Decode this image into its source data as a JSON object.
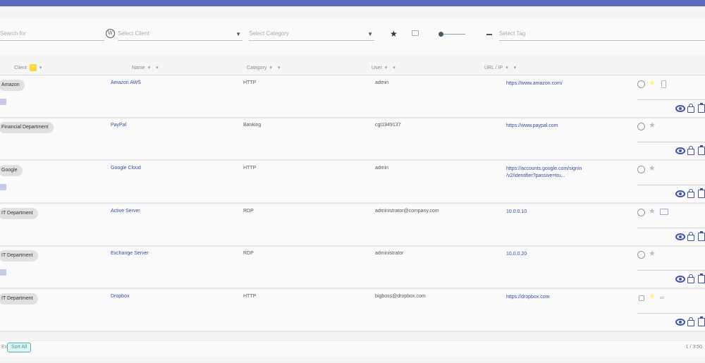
{
  "filters": {
    "search_placeholder": "Search for",
    "client_placeholder": "Select Client",
    "category_placeholder": "Select Category",
    "tag_placeholder": "Select Tag",
    "wordpress_icon_glyph": "W",
    "star_glyph": "★",
    "caret_glyph": "▼"
  },
  "columns": {
    "client": "Client",
    "name": "Name",
    "category": "Category",
    "user": "User",
    "url": "URL / IP",
    "sort_glyphs": "▾ ▾",
    "client_badge_glyph": "+"
  },
  "rows": [
    {
      "client": "Amazon",
      "name": "Amazon AWS",
      "category": "HTTP",
      "user": "admin",
      "url": "https://www.amazon.com/",
      "url2": "",
      "has_square": true,
      "icons": [
        "clock",
        "star-gold",
        "clipboard-grey"
      ]
    },
    {
      "client": "Financial Department",
      "name": "PayPal",
      "category": "Banking",
      "user": "cgt1949137",
      "url": "https://www.paypal.com",
      "url2": "",
      "has_square": false,
      "icons": [
        "clock",
        "star"
      ]
    },
    {
      "client": "Google",
      "name": "Google Cloud",
      "category": "HTTP",
      "user": "admin",
      "url": "https://accounts.google.com/signin",
      "url2": "/v2/identifier?passive=tru...",
      "has_square": true,
      "icons": [
        "clock",
        "star"
      ]
    },
    {
      "client": "IT Department",
      "name": "Active Server",
      "category": "RDP",
      "user": "administrator@company.com",
      "url": "10.0.0.10",
      "url2": "",
      "has_square": false,
      "icons": [
        "clock",
        "star",
        "message"
      ]
    },
    {
      "client": "IT Department",
      "name": "Exchange Server",
      "category": "RDP",
      "user": "administrator",
      "url": "10.0.0.20",
      "url2": "",
      "has_square": true,
      "icons": [
        "clock",
        "star"
      ]
    },
    {
      "client": "IT Department",
      "name": "Dropbox",
      "category": "HTTP",
      "user": "bigboss@dropbox.com",
      "url": "https://dropbox.com",
      "url2": "",
      "has_square": false,
      "icons": [
        "padlock",
        "star-gold",
        "link"
      ]
    }
  ],
  "footer": {
    "left_text": "Ex",
    "chip_label": "Sort All",
    "right_text": "1 / 3:50"
  },
  "colors": {
    "topbar": "#5c6bc0",
    "action_blue": "#3f51b5",
    "link_blue": "#3949ab"
  }
}
